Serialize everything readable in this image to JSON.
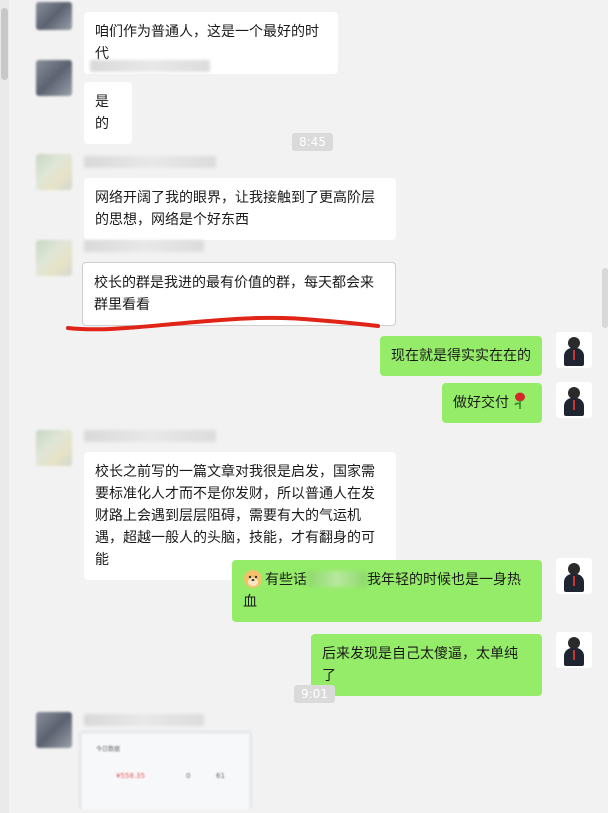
{
  "messages": [
    {
      "side": "left",
      "text": "咱们作为普通人，这是一个最好的时代"
    },
    {
      "side": "left",
      "text": "是的"
    },
    {
      "side": "left",
      "text": "网络开阔了我的眼界，让我接触到了更高阶层的思想，网络是个好东西"
    },
    {
      "side": "left",
      "text": "校长的群是我进的最有价值的群，每天都会来群里看看"
    },
    {
      "side": "right",
      "text": "现在就是得实实在在的"
    },
    {
      "side": "right",
      "text": "做好交付"
    },
    {
      "side": "left",
      "text": "校长之前写的一篇文章对我很是启发，国家需要标准化人才而不是你发财，所以普通人在发财路上会遇到层层阻碍，需要有大的气运机遇，超越一般人的头脑，技能，才有翻身的可能"
    },
    {
      "side": "right",
      "text_before": "有些话",
      "text_after": "我年轻的时候也是一身热血"
    },
    {
      "side": "right",
      "text": "后来发现是自己太傻逼，太单纯了"
    }
  ],
  "timestamps": [
    "8:45",
    "9:01"
  ],
  "image_message": {
    "title": "今日数据",
    "value_main": "¥558.35",
    "value_2": "0",
    "value_3": "61"
  },
  "colors": {
    "background": "#f2f2f2",
    "incoming_bubble": "#ffffff",
    "outgoing_bubble": "#95ec69",
    "underline_annotation": "#e02418",
    "timestamp_bg": "#dadada"
  },
  "icons": [
    "rose-emoji-icon",
    "doge-emoji-icon",
    "avatar-icon"
  ]
}
